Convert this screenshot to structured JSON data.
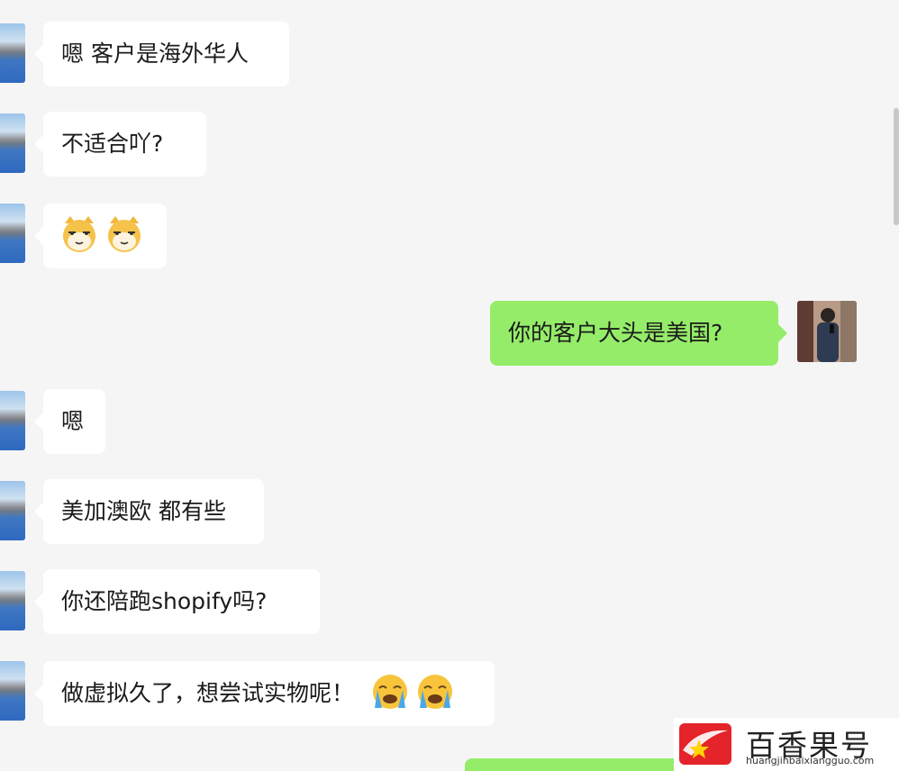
{
  "messages": [
    {
      "side": "left",
      "text": "嗯 客户是海外华人"
    },
    {
      "side": "left",
      "text": "不适合吖?"
    },
    {
      "side": "left",
      "emoji": [
        "cat-face",
        "cat-face"
      ]
    },
    {
      "side": "right",
      "text": "你的客户大头是美国?"
    },
    {
      "side": "left",
      "text": "嗯"
    },
    {
      "side": "left",
      "text": "美加澳欧 都有些"
    },
    {
      "side": "left",
      "text": "你还陪跑shopify吗?"
    },
    {
      "side": "left",
      "text": "做虚拟久了，想尝试实物呢！",
      "emoji": [
        "loudly-crying-face",
        "loudly-crying-face"
      ]
    }
  ],
  "watermark": {
    "title": "百香果号",
    "url": "huangjinbaixiangguo.com"
  },
  "colors": {
    "background": "#f5f5f5",
    "incoming_bubble": "#ffffff",
    "outgoing_bubble": "#95ec69",
    "brand_red": "#e4242a"
  }
}
